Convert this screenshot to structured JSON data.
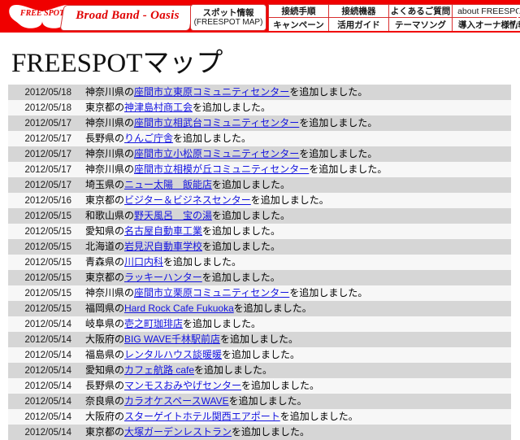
{
  "header": {
    "logo_text": "FREE SPOT",
    "brand_tab": "Broad Band - Oasis",
    "spot_button": {
      "line1": "スポット情報",
      "line2": "(FREESPOT MAP)"
    },
    "nav_items": [
      "接続手順",
      "接続機器",
      "よくあるご質問",
      "about FREESPOT",
      "キャンペーン",
      "活用ガイド",
      "テーマソング",
      "導入オーナ様情報"
    ],
    "colors": {
      "bar": "#f00000",
      "border": "#d83030",
      "brand_text": "#e00000"
    }
  },
  "page_title": "FREESPOTマップ",
  "list": {
    "suffix": "を追加しました。",
    "rows": [
      {
        "date": "2012/05/18",
        "pref": "神奈川県の",
        "link": "座間市立東原コミュニティセンター"
      },
      {
        "date": "2012/05/18",
        "pref": "東京都の",
        "link": "神津島村商工会"
      },
      {
        "date": "2012/05/17",
        "pref": "神奈川県の",
        "link": "座間市立相武台コミュニティセンター"
      },
      {
        "date": "2012/05/17",
        "pref": "長野県の",
        "link": "りんご庁舎"
      },
      {
        "date": "2012/05/17",
        "pref": "神奈川県の",
        "link": "座間市立小松原コミュニティセンター"
      },
      {
        "date": "2012/05/17",
        "pref": "神奈川県の",
        "link": "座間市立相模が丘コミュニティセンター"
      },
      {
        "date": "2012/05/17",
        "pref": "埼玉県の",
        "link": "ニュー太陽　飯能店"
      },
      {
        "date": "2012/05/16",
        "pref": "東京都の",
        "link": "ビジター＆ビジネスセンター"
      },
      {
        "date": "2012/05/15",
        "pref": "和歌山県の",
        "link": "野天風呂　宝の湯"
      },
      {
        "date": "2012/05/15",
        "pref": "愛知県の",
        "link": "名古屋自動車工業"
      },
      {
        "date": "2012/05/15",
        "pref": "北海道の",
        "link": "岩見沢自動車学校"
      },
      {
        "date": "2012/05/15",
        "pref": "青森県の",
        "link": "川口内科"
      },
      {
        "date": "2012/05/15",
        "pref": "東京都の",
        "link": "ラッキーハンター"
      },
      {
        "date": "2012/05/15",
        "pref": "神奈川県の",
        "link": "座間市立栗原コミュニティセンター"
      },
      {
        "date": "2012/05/15",
        "pref": "福岡県の",
        "link": "Hard Rock Cafe Fukuoka"
      },
      {
        "date": "2012/05/14",
        "pref": "岐阜県の",
        "link": "壱之町珈琲店"
      },
      {
        "date": "2012/05/14",
        "pref": "大阪府の",
        "link": "BIG WAVE千林駅前店"
      },
      {
        "date": "2012/05/14",
        "pref": "福島県の",
        "link": "レンタルハウス談暖暖"
      },
      {
        "date": "2012/05/14",
        "pref": "愛知県の",
        "link": "カフェ航路 cafe"
      },
      {
        "date": "2012/05/14",
        "pref": "長野県の",
        "link": "マンモスおみやげセンター"
      },
      {
        "date": "2012/05/14",
        "pref": "奈良県の",
        "link": "カラオケスペースWAVE"
      },
      {
        "date": "2012/05/14",
        "pref": "大阪府の",
        "link": "スターゲイトホテル関西エアポート"
      },
      {
        "date": "2012/05/14",
        "pref": "東京都の",
        "link": "大塚ガーデンレストラン"
      }
    ]
  }
}
